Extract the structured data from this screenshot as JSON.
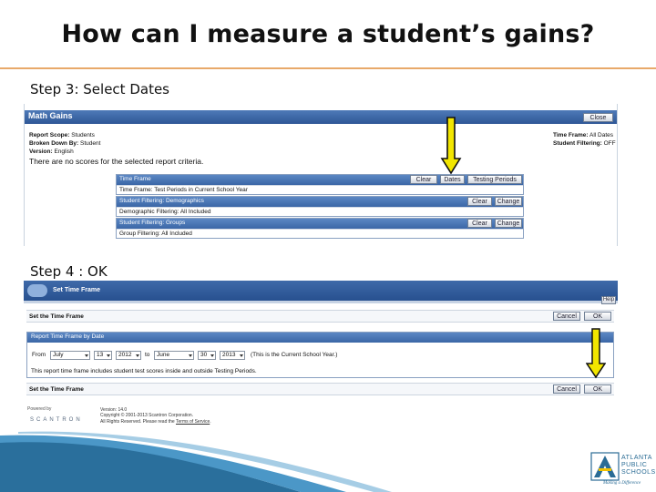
{
  "slide": {
    "title": "How can I measure a student’s gains?",
    "step3_label": "Step 3: Select Dates",
    "step4_label": "Step 4 : OK"
  },
  "math_gains": {
    "title": "Math Gains",
    "close_label": "Close",
    "report_scope_label": "Report Scope:",
    "report_scope_value": "Students",
    "broken_down_label": "Broken Down By:",
    "broken_down_value": "Student",
    "version_label": "Version:",
    "version_value": "English",
    "time_frame_label": "Time Frame:",
    "time_frame_value": "All Dates",
    "student_filtering_label": "Student Filtering:",
    "student_filtering_value": "OFF",
    "no_scores_message": "There are no scores for the selected report criteria.",
    "criteria": [
      {
        "header": "Time Frame",
        "buttons": [
          "Clear",
          "Dates",
          "Testing Periods"
        ],
        "row": "Time Frame: Test Periods in Current School Year"
      },
      {
        "header": "Student Filtering: Demographics",
        "buttons": [
          "Clear",
          "Change"
        ],
        "row": "Demographic Filtering: All Included"
      },
      {
        "header": "Student Filtering: Groups",
        "buttons": [
          "Clear",
          "Change"
        ],
        "row": "Group Filtering: All Included"
      }
    ]
  },
  "time_frame_dialog": {
    "title": "Set Time Frame",
    "help_label": "Help",
    "set_time_frame_label": "Set the Time Frame",
    "cancel_label": "Cancel",
    "ok_label": "OK",
    "section_title": "Report Time Frame by Date",
    "from_label": "From",
    "from_month": "July",
    "from_day": "13",
    "from_year": "2012",
    "to_label": "to",
    "to_month": "June",
    "to_day": "30",
    "to_year": "2013",
    "current_year_note": "(This is the Current School Year.)",
    "includes_note": "This report time frame includes student test scores inside and outside Testing Periods."
  },
  "footer": {
    "powered_by": "Powered by",
    "brand": "SCANTRON",
    "version_line": "Version: 14.0",
    "copyright_line": "Copyright © 2001-2013 Scantron Corporation.",
    "rights_line": "All Rights Reserved. Please read the",
    "terms_link": "Terms of Service",
    "terms_end": "."
  },
  "aps": {
    "line1": "ATLANTA",
    "line2": "PUBLIC",
    "line3": "SCHOOLS",
    "tagline": "Making a Difference"
  },
  "colors": {
    "accent_rule": "#e8a96a",
    "header_blue": "#2f5796",
    "arrow_yellow": "#f2e600"
  }
}
